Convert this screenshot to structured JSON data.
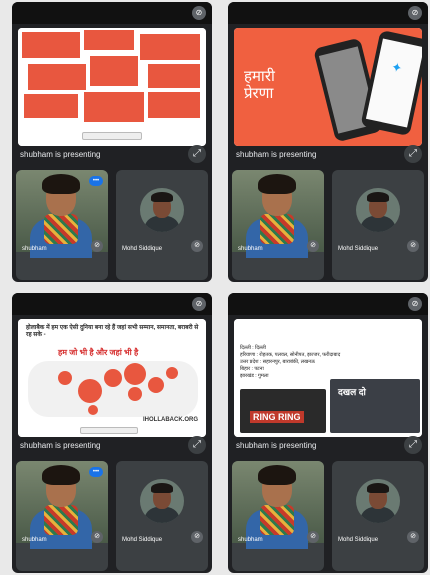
{
  "panels": [
    {
      "presenter_label": "shubham is presenting",
      "slide_type": "notes-board",
      "notes": [
        "",
        "",
        "",
        "",
        "",
        "",
        "",
        "",
        ""
      ]
    },
    {
      "presenter_label": "shubham is presenting",
      "slide_type": "inspiration",
      "slide_title_line1": "हमारी",
      "slide_title_line2": "प्रेरणा"
    },
    {
      "presenter_label": "shubham is presenting",
      "slide_type": "map",
      "slide_text": "होलाबैक में हम एक ऐसी दुनिया बना रहे हैं जहां सभी सम्मान, समानता, बराबरी से रह सके -",
      "slide_highlight": "हम जो भी है और जहां भी है",
      "slide_url": "IHOLLABACK.ORG"
    },
    {
      "presenter_label": "shubham is presenting",
      "slide_type": "campaign",
      "slide_heading": "",
      "slide_list": [
        "दिल्ली : दिल्ली",
        "हरियाणा : रोहतक, पलवल, सोनीपत, झज्जर, फरीदाबाद",
        "उत्तर प्रदेश : सहारनपुर, बाराबंकी, लखनऊ",
        "बिहार : पटना",
        "झारखंड : गुमला"
      ],
      "poster1": "RING RING",
      "poster2": "दखल दो"
    }
  ],
  "participants": {
    "camera_user": "shubham",
    "avatar_user": "Mohd Siddique"
  },
  "icons": {
    "mute": "mic-off-icon",
    "fit": "fit-screen-icon",
    "speaking": "speaking-indicator-icon"
  },
  "colors": {
    "accent": "#e8573f",
    "meet_dark": "#202124",
    "blue": "#1a73e8"
  }
}
